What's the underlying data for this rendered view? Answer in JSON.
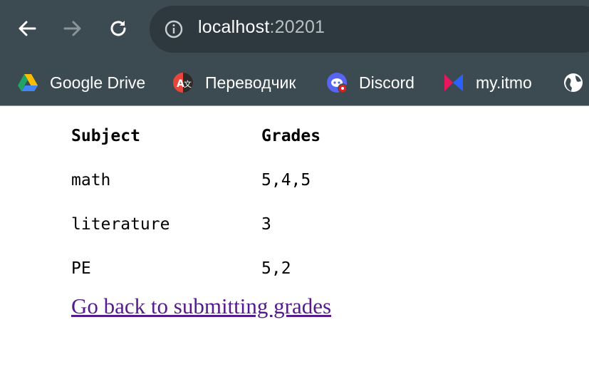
{
  "browser": {
    "url_host": "localhost",
    "url_port": ":20201",
    "accent": "#3c4a52",
    "bookmarks": [
      {
        "label": "Google Drive",
        "icon": "google-drive-icon"
      },
      {
        "label": "Переводчик",
        "icon": "translate-icon"
      },
      {
        "label": "Discord",
        "icon": "discord-icon"
      },
      {
        "label": "my.itmo",
        "icon": "itmo-icon"
      },
      {
        "label": "",
        "icon": "globe-icon"
      }
    ]
  },
  "table": {
    "headers": [
      "Subject",
      "Grades"
    ],
    "rows": [
      [
        "math",
        "5,4,5"
      ],
      [
        "literature",
        "3"
      ],
      [
        "PE",
        "5,2"
      ]
    ]
  },
  "link": {
    "label": "Go back to submitting grades",
    "color": "#551a8b"
  }
}
